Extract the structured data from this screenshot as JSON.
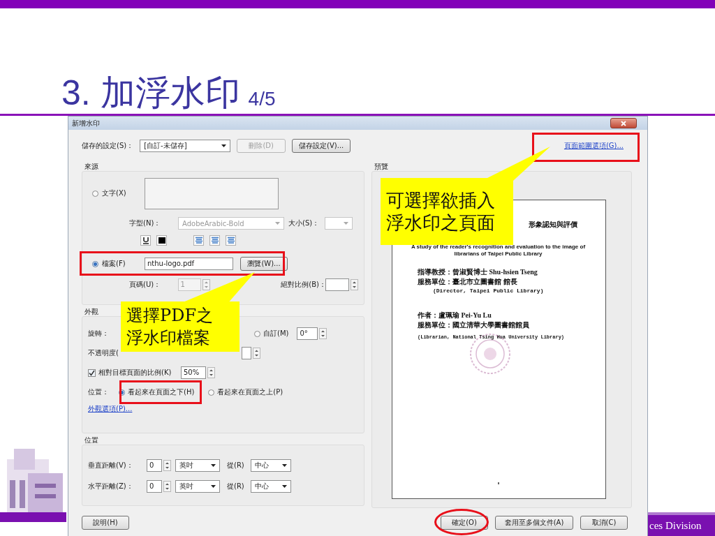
{
  "slide": {
    "title": "3. 加浮水印",
    "page_indicator": "4/5",
    "footer": "ces Division"
  },
  "dialog": {
    "title": "新增水印",
    "saved_settings": {
      "label": "儲存的設定(S)：",
      "value": "[自訂-未儲存]",
      "buttons": [
        {
          "label": "刪除(D)",
          "disabled": true
        },
        {
          "label": "儲存設定(V)...",
          "disabled": false
        }
      ]
    },
    "page_range_link": "頁面範圍選項(G)...",
    "source": {
      "title": "來源",
      "options": [
        {
          "label": "文字(X)",
          "selected": false
        },
        {
          "label": "檔案(F)",
          "selected": true
        }
      ],
      "font_label": "字型(N)：",
      "font_value": "AdobeArabic-Bold",
      "size_label": "大小(S)：",
      "file_value": "nthu-logo.pdf",
      "browse": "瀏覽(W)...",
      "page_label": "頁碼(U)：",
      "page_value": "1",
      "scale_label": "絕對比例(B)："
    },
    "appearance": {
      "title": "外觀",
      "rotation_label": "旋轉：",
      "rotation_custom": {
        "label": "自訂(M)",
        "selected": false,
        "value": "0°"
      },
      "opacity_label": "不透明度(",
      "relative_scale": {
        "label": "相對目標頁面的比例(K)",
        "checked": true,
        "value": "50%"
      },
      "position_label": "位置：",
      "position_options": [
        {
          "label": "看起來在頁面之下(H)",
          "selected": true
        },
        {
          "label": "看起來在頁面之上(P)",
          "selected": false
        }
      ],
      "options_link": "外觀選項(P)..."
    },
    "position": {
      "title": "位置",
      "rows": [
        {
          "label": "垂直距離(V)：",
          "value": "0",
          "unit": "英吋",
          "from_label": "從(R)",
          "from": "中心"
        },
        {
          "label": "水平距離(Z)：",
          "value": "0",
          "unit": "英吋",
          "from_label": "從(R)",
          "from": "中心"
        }
      ]
    },
    "preview": {
      "title": "預覽",
      "lines": [
        {
          "kind": "heading",
          "text": "形象認知與評價"
        },
        {
          "kind": "english",
          "text": "A study of the reader's recognition and evaluation to the image of"
        },
        {
          "kind": "english",
          "text": "librarians of Taipei Public Library"
        },
        {
          "kind": "body",
          "text": "指導教授：曾淑賢博士 Shu-hsien Tseng"
        },
        {
          "kind": "body",
          "text": "服務單位：臺北市立圖書館 館長"
        },
        {
          "kind": "indent",
          "text": "(Director, Taipei Public Library)"
        },
        {
          "kind": "gap-body",
          "text": "作者：盧珮瑜 Pei-Yu Lu"
        },
        {
          "kind": "body",
          "text": "服務單位：國立清華大學圖書館館員"
        },
        {
          "kind": "note",
          "text": "(Librarian, National Tsing Hua University Library)"
        }
      ]
    },
    "help_button": "說明(H)",
    "actions": [
      "確定(O)",
      "套用至多個文件(A)",
      "取消(C)"
    ]
  },
  "callouts": [
    {
      "lines": [
        "可選擇欲插入",
        "浮水印之頁面"
      ]
    },
    {
      "lines": [
        "選擇PDF之",
        "浮水印檔案"
      ]
    }
  ]
}
